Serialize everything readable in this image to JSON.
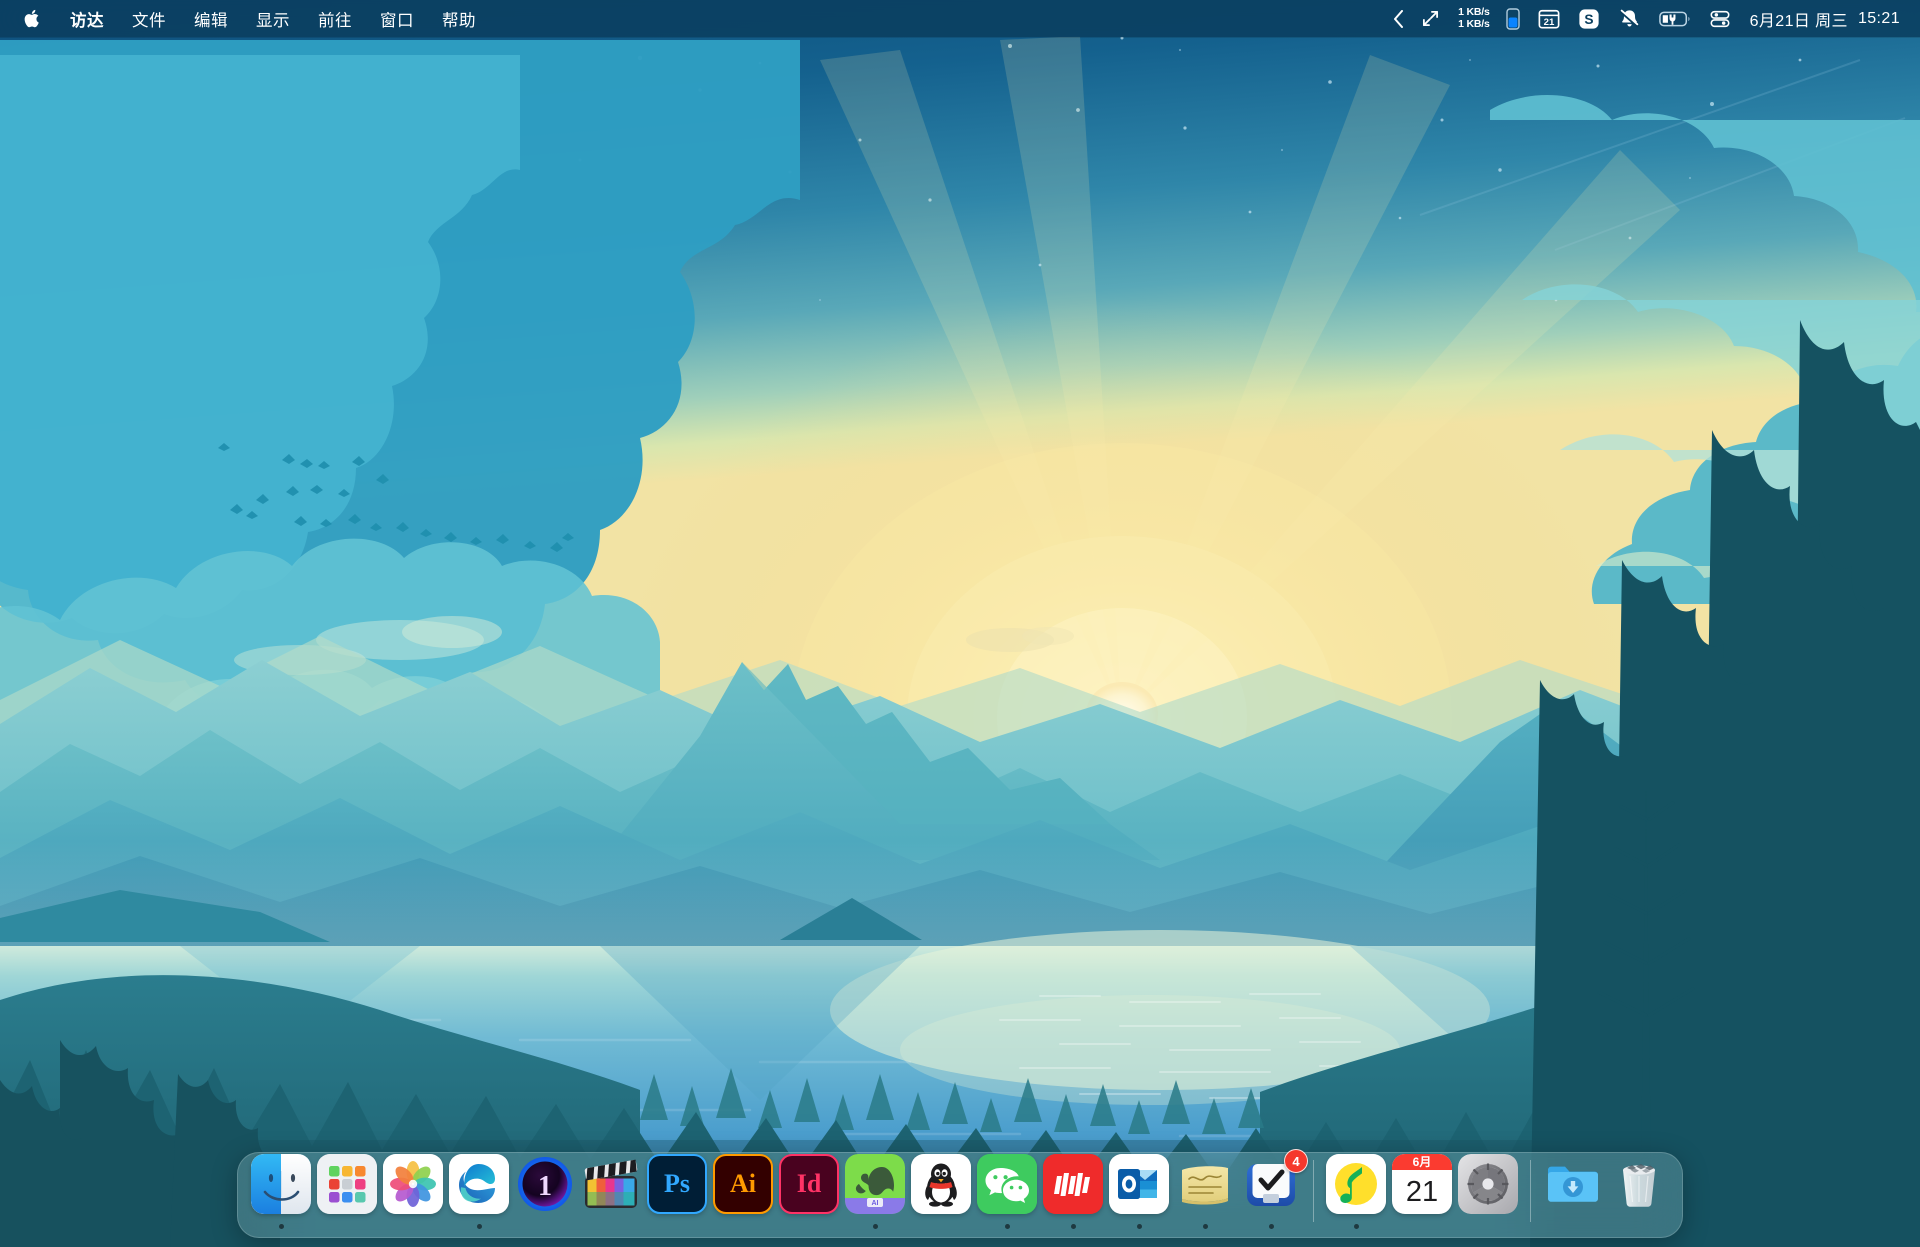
{
  "menubar": {
    "apple_icon": "apple-logo-icon",
    "items": [
      {
        "label": "访达",
        "bold": true
      },
      {
        "label": "文件",
        "bold": false
      },
      {
        "label": "编辑",
        "bold": false
      },
      {
        "label": "显示",
        "bold": false
      },
      {
        "label": "前往",
        "bold": false
      },
      {
        "label": "窗口",
        "bold": false
      },
      {
        "label": "帮助",
        "bold": false
      }
    ],
    "status": {
      "chevron_left_icon": "chevron-left-icon",
      "expand_icon": "expand-arrows-icon",
      "network_up": "1 KB/s",
      "network_down": "1 KB/s",
      "memory_icon": "memory-gauge-icon",
      "calendar_icon": "calendar-21-icon",
      "calendar_day": "21",
      "snipaste_icon": "snipaste-s-icon",
      "do_not_disturb_icon": "bell-slash-icon",
      "battery_icon": "battery-charging-icon",
      "control_center_icon": "control-center-icon",
      "date": "6月21日 周三",
      "time": "15:21"
    }
  },
  "dock": {
    "items": [
      {
        "name": "finder",
        "label": "访达",
        "running": true,
        "badge": null
      },
      {
        "name": "launchpad",
        "label": "启动台",
        "running": false,
        "badge": null
      },
      {
        "name": "photos",
        "label": "照片",
        "running": false,
        "badge": null
      },
      {
        "name": "microsoft-edge",
        "label": "Microsoft Edge",
        "running": true,
        "badge": null
      },
      {
        "name": "1password",
        "label": "1Password",
        "running": false,
        "badge": null
      },
      {
        "name": "final-cut-pro",
        "label": "Final Cut Pro",
        "running": false,
        "badge": null
      },
      {
        "name": "photoshop",
        "label": "Adobe Photoshop",
        "running": false,
        "badge": null
      },
      {
        "name": "illustrator",
        "label": "Adobe Illustrator",
        "running": false,
        "badge": null
      },
      {
        "name": "indesign",
        "label": "Adobe InDesign",
        "running": false,
        "badge": null
      },
      {
        "name": "evernote",
        "label": "印象笔记",
        "running": true,
        "badge": null
      },
      {
        "name": "qq",
        "label": "QQ",
        "running": false,
        "badge": null
      },
      {
        "name": "wechat",
        "label": "微信",
        "running": true,
        "badge": null
      },
      {
        "name": "dingtalk-red",
        "label": "摹客",
        "running": true,
        "badge": null
      },
      {
        "name": "outlook",
        "label": "Outlook",
        "running": true,
        "badge": null
      },
      {
        "name": "stickies",
        "label": "备忘录",
        "running": true,
        "badge": null
      },
      {
        "name": "things-todo",
        "label": "待办事项",
        "running": true,
        "badge": "4"
      }
    ],
    "items_right": [
      {
        "name": "qq-music",
        "label": "QQ音乐",
        "running": true,
        "badge": null
      },
      {
        "name": "calendar",
        "label": "日历",
        "running": false,
        "badge": null,
        "calendar_month": "6月",
        "calendar_day": "21"
      },
      {
        "name": "system-preferences",
        "label": "系统偏好设置",
        "running": false,
        "badge": null
      }
    ],
    "items_trash": [
      {
        "name": "downloads-folder",
        "label": "下载",
        "running": false,
        "badge": null
      },
      {
        "name": "trash",
        "label": "废纸篓",
        "running": false,
        "badge": null
      }
    ],
    "labels": {
      "ps": "Ps",
      "ai": "Ai",
      "id": "Id",
      "one": "1",
      "snip": "S"
    }
  },
  "colors": {
    "menubar_bg": "#0a3e5e",
    "sky_top": "#0e5a86",
    "sky_horizon": "#f3e2a8",
    "water": "#3a8fc4",
    "dock_bg": "#6fa3ad",
    "badge_red": "#f5382c",
    "accent_blue": "#2f8fd8"
  },
  "wallpaper": {
    "scene": "sunrise-mountain-lake-illustration",
    "elements": [
      "sky-gradient",
      "clouds",
      "sun",
      "sun-rays",
      "birds-flock",
      "stars",
      "mountain-ranges",
      "lake",
      "pine-forest"
    ]
  }
}
